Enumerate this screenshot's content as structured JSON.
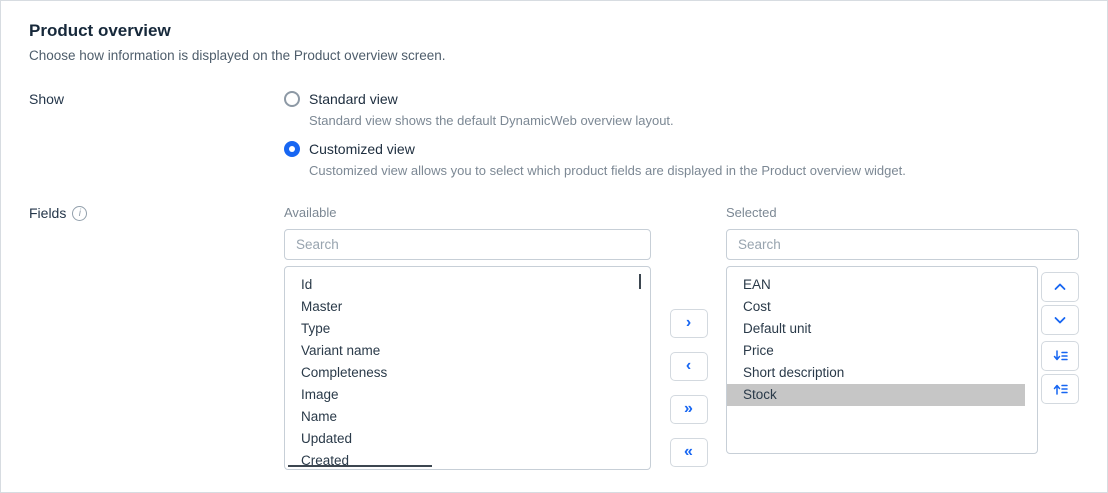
{
  "page": {
    "title": "Product overview",
    "subtitle": "Choose how information is displayed on the Product overview screen."
  },
  "show": {
    "label": "Show",
    "options": [
      {
        "label": "Standard view",
        "description": "Standard view shows the default DynamicWeb overview layout.",
        "selected": false
      },
      {
        "label": "Customized view",
        "description": "Customized view allows you to select which product fields are displayed in the Product overview widget.",
        "selected": true
      }
    ]
  },
  "fields": {
    "label": "Fields",
    "info_icon": "i",
    "available": {
      "label": "Available",
      "search_placeholder": "Search",
      "items": [
        "Id",
        "Master",
        "Type",
        "Variant name",
        "Completeness",
        "Image",
        "Name",
        "Updated",
        "Created"
      ]
    },
    "selected": {
      "label": "Selected",
      "search_placeholder": "Search",
      "items": [
        "EAN",
        "Cost",
        "Default unit",
        "Price",
        "Short description",
        "Stock"
      ],
      "highlighted": "Stock"
    },
    "transfer_buttons": [
      "›",
      "‹",
      "»",
      "«"
    ],
    "order_icons": [
      "chevron-up-icon",
      "chevron-down-icon",
      "move-to-bottom-icon",
      "move-to-top-icon"
    ]
  },
  "colors": {
    "accent_blue": "#1766f2",
    "selected_row_gray": "#c6c6c6",
    "border_gray": "#c7cfd7"
  }
}
